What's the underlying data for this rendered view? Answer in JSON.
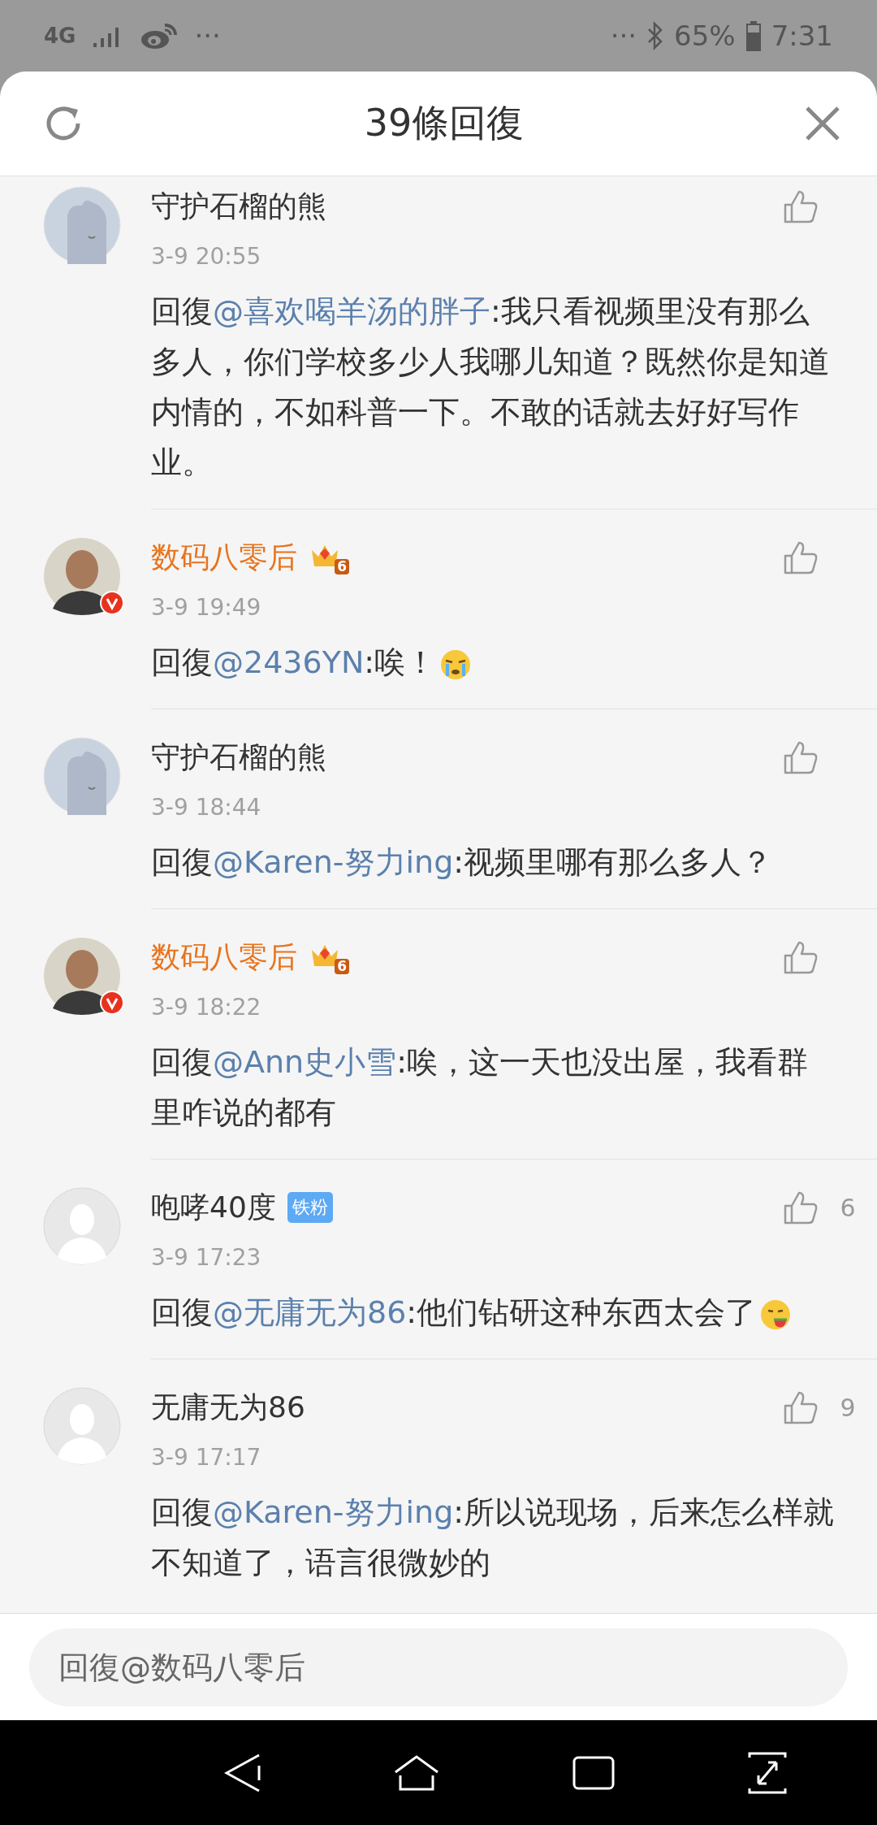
{
  "status_bar": {
    "network": "4G",
    "left_more": "···",
    "right_more": "···",
    "battery": "65%",
    "time": "7:31"
  },
  "header": {
    "title": "39條回復"
  },
  "comments": [
    {
      "avatar": {
        "kind": "bear"
      },
      "verified": false,
      "name": "守护石榴的熊",
      "time": "3-9 20:55",
      "reply_prefix": "回復",
      "mention": "@喜欢喝羊汤的胖子",
      "text": ":我只看视频里没有那么多人，你们学校多少人我哪儿知道？既然你是知道内情的，不如科普一下。不敢的话就去好好写作业。"
    },
    {
      "avatar": {
        "kind": "person"
      },
      "verified": true,
      "name": "数码八零后",
      "vip_level": "6",
      "time": "3-9 19:49",
      "reply_prefix": "回復",
      "mention": "@2436YN",
      "text": ":唉！",
      "emoji": {
        "kind": "crying"
      }
    },
    {
      "avatar": {
        "kind": "bear"
      },
      "verified": false,
      "name": "守护石榴的熊",
      "time": "3-9 18:44",
      "reply_prefix": "回復",
      "mention": "@Karen-努力ing",
      "text": ":视频里哪有那么多人？"
    },
    {
      "avatar": {
        "kind": "person"
      },
      "verified": true,
      "name": "数码八零后",
      "vip_level": "6",
      "time": "3-9 18:22",
      "reply_prefix": "回復",
      "mention": "@Ann史小雪",
      "text": ":唉，这一天也没出屋，我看群里咋说的都有"
    },
    {
      "avatar": {
        "kind": "default"
      },
      "verified": false,
      "name": "咆哮40度",
      "fan_badge": "铁粉",
      "likes": "6",
      "time": "3-9 17:23",
      "reply_prefix": "回復",
      "mention": "@无庸无为86",
      "text": ":他们钻研这种东西太会了",
      "emoji": {
        "kind": "eating"
      }
    },
    {
      "avatar": {
        "kind": "default"
      },
      "verified": false,
      "name": "无庸无为86",
      "likes": "9",
      "time": "3-9 17:17",
      "reply_prefix": "回復",
      "mention": "@Karen-努力ing",
      "text": ":所以说现场，后来怎么样就不知道了，语言很微妙的"
    }
  ],
  "reply_input": {
    "placeholder": "回復@数码八零后"
  }
}
